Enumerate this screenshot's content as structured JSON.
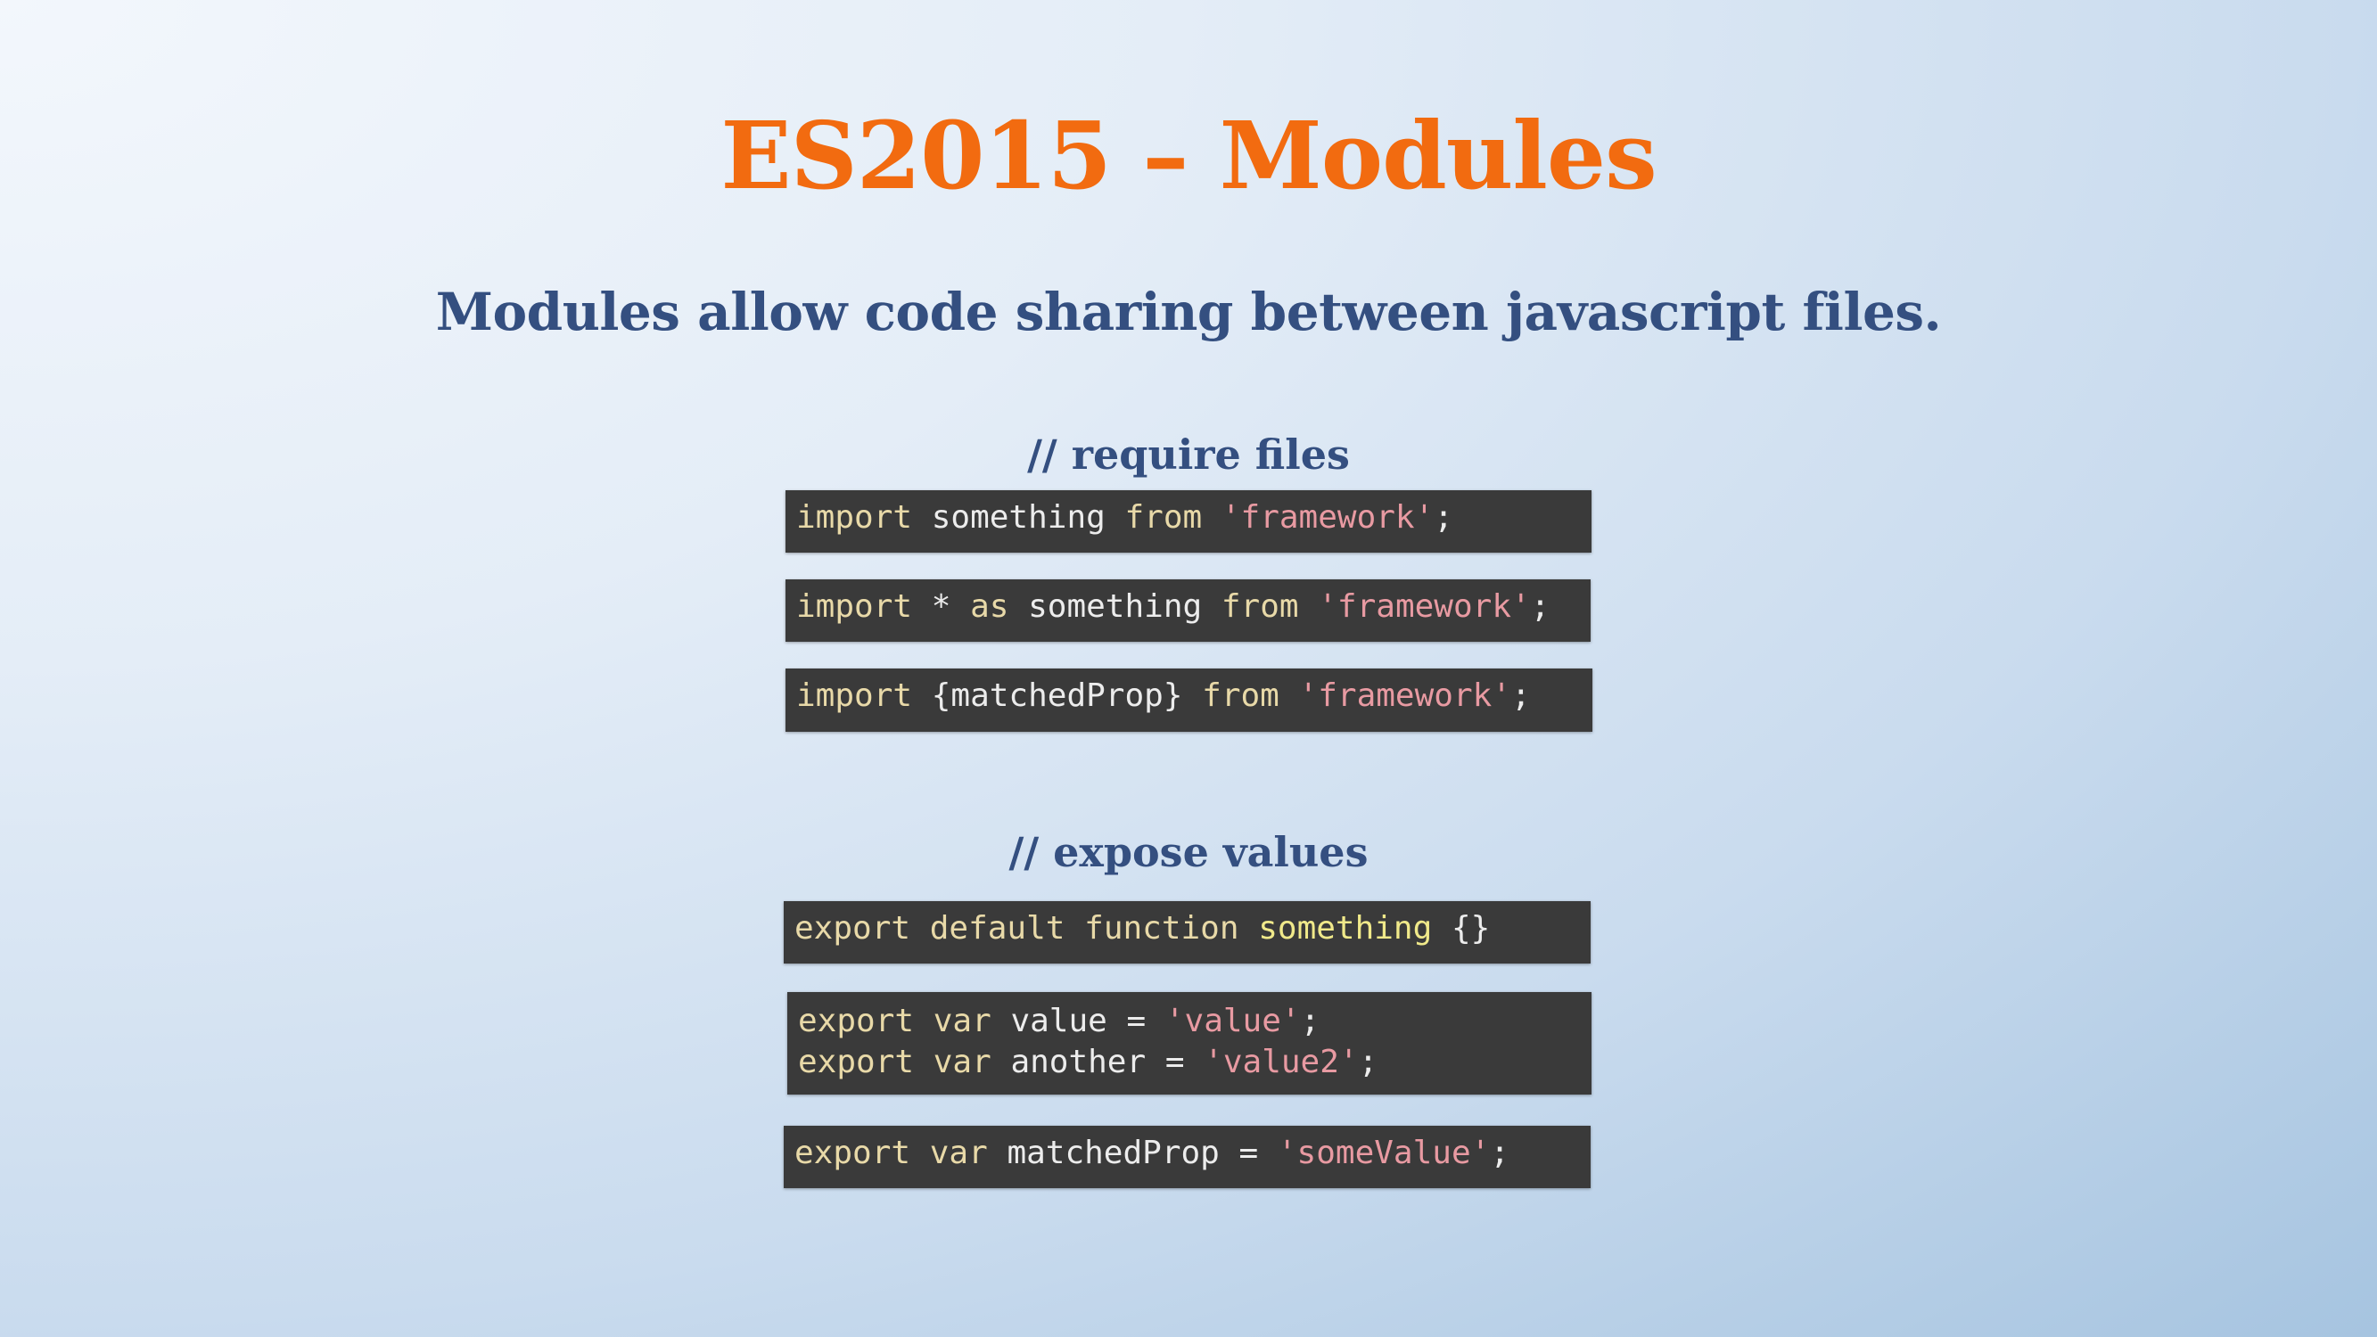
{
  "slide": {
    "title": "ES2015 – Modules",
    "subtitle": "Modules allow code sharing between javascript files."
  },
  "require_section": {
    "heading": "// require files",
    "snippets": [
      {
        "kw1": "import",
        "p1": " something ",
        "kw2": "from",
        "p2": " ",
        "str": "'framework'",
        "end": ";"
      },
      {
        "kw1": "import",
        "p1": " * ",
        "kw2": "as",
        "p2": " something ",
        "kw3": "from",
        "p3": " ",
        "str": "'framework'",
        "end": ";"
      },
      {
        "kw1": "import",
        "p1": " {matchedProp} ",
        "kw2": "from",
        "p2": " ",
        "str": "'framework'",
        "end": ";"
      }
    ]
  },
  "expose_section": {
    "heading": "// expose values",
    "snippets": [
      {
        "kw1": "export",
        "p1": " ",
        "kw2": "default",
        "p2": " ",
        "kw3": "function",
        "p3": " ",
        "name": "something",
        "end": " {}"
      },
      {
        "line1": {
          "kw1": "export",
          "p1": " ",
          "kw2": "var",
          "p2": " value = ",
          "str": "'value'",
          "end": ";"
        },
        "line2": {
          "kw1": "export",
          "p1": " ",
          "kw2": "var",
          "p2": " another = ",
          "str": "'value2'",
          "end": ";"
        }
      },
      {
        "kw1": "export",
        "p1": " ",
        "kw2": "var",
        "p2": " matchedProp = ",
        "str": "'someValue'",
        "end": ";"
      }
    ]
  },
  "colors": {
    "title": "#f26b10",
    "heading": "#344f80",
    "code_background": "#3a3a3a",
    "keyword": "#e8d9a8",
    "string": "#e89aa2"
  }
}
